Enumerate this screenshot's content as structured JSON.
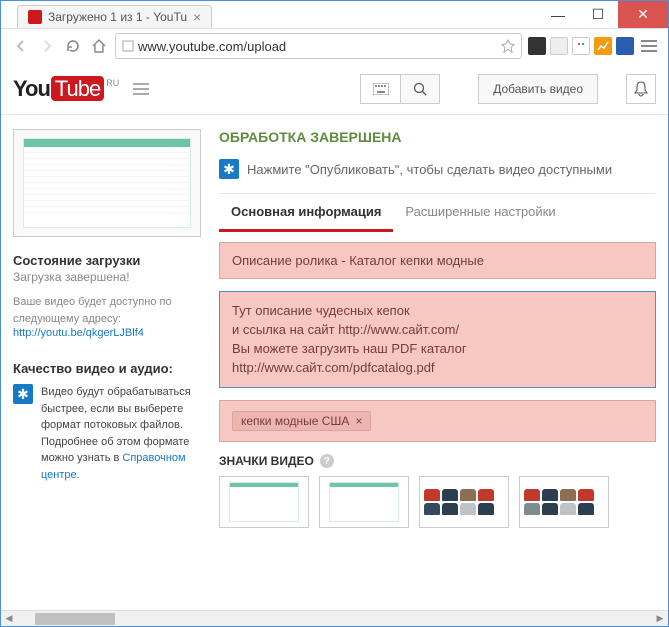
{
  "browser": {
    "tab_title": "Загружено 1 из 1 - YouTu",
    "url_host": "www.youtube.com",
    "url_path": "/upload"
  },
  "yt": {
    "logo_ru": "RU",
    "upload_button": "Добавить видео"
  },
  "sidebar": {
    "status_title": "Состояние загрузки",
    "status_complete": "Загрузка завершена!",
    "status_note": "Ваше видео будет доступно по следующему адресу:",
    "status_link": "http://youtu.be/qkgerLJBlf4",
    "quality_title": "Качество видео и аудио:",
    "quality_text": "Видео будут обрабатываться быстрее, если вы выберете формат потоковых файлов. Подробнее об этом формате можно узнать в ",
    "quality_link": "Справочном центре"
  },
  "main": {
    "processing_done": "ОБРАБОТКА ЗАВЕРШЕНА",
    "publish_hint": "Нажмите \"Опубликовать\", чтобы сделать видео доступными",
    "tab_basic": "Основная информация",
    "tab_advanced": "Расширенные настройки",
    "title_field": "Описание ролика - Каталог кепки модные",
    "desc_line1": "Тут описание чудесных кепок",
    "desc_line2": "и ссылка на сайт http://www.сайт.com/",
    "desc_line3": "Вы можете загрузить наш PDF каталог",
    "desc_line4": "http://www.сайт.com/pdfcatalog.pdf",
    "tag1": "кепки модные США",
    "thumbs_title": "ЗНАЧКИ ВИДЕО"
  }
}
